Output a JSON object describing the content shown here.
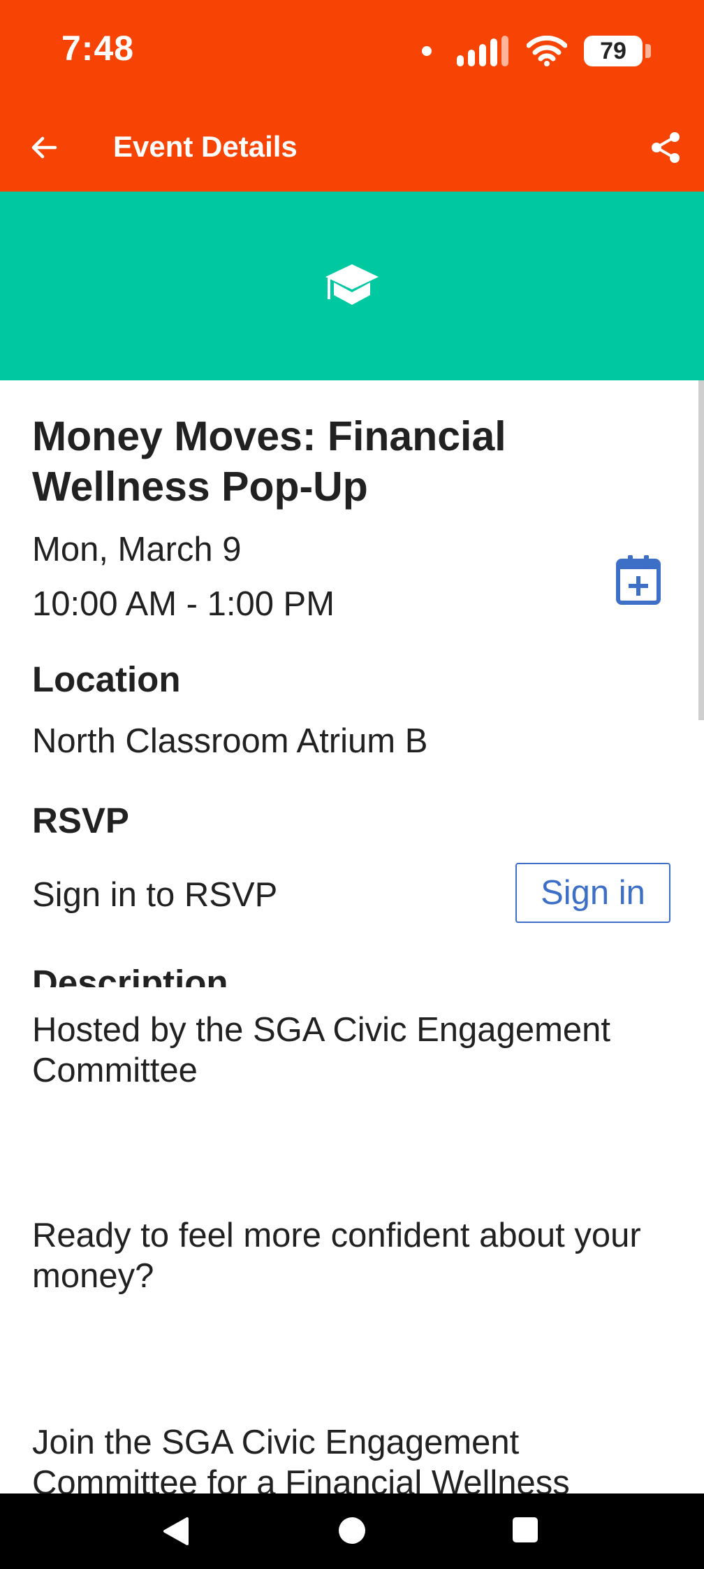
{
  "status_bar": {
    "time": "7:48",
    "battery": "79",
    "icons": [
      "notification-dot-icon",
      "signal-icon",
      "wifi-icon",
      "battery-icon"
    ]
  },
  "app_bar": {
    "title": "Event Details",
    "back_icon": "arrow-left-icon",
    "share_icon": "share-icon",
    "background": "#f74304"
  },
  "hero": {
    "icon": "graduation-cap-icon",
    "background": "#00c8a0"
  },
  "event": {
    "title": "Money Moves: Financial Wellness Pop-Up",
    "date": "Mon, March 9",
    "time": "10:00 AM - 1:00 PM",
    "add_to_calendar_icon": "calendar-add-icon",
    "location_heading": "Location",
    "location": "North Classroom Atrium B",
    "rsvp_heading": "RSVP",
    "rsvp_text": "Sign in to RSVP",
    "signin_label": "Sign in",
    "description_heading": "Description",
    "description_paragraphs": [
      "Hosted by the SGA Civic Engagement Committee",
      "Ready to feel more confident about your money?",
      "Join the SGA Civic Engagement Committee for a Financial Wellness"
    ]
  },
  "colors": {
    "accent_blue": "#3d6fc7",
    "text": "#212121"
  },
  "nav_bar": {
    "icons": [
      "nav-back-icon",
      "nav-home-icon",
      "nav-recents-icon"
    ]
  }
}
